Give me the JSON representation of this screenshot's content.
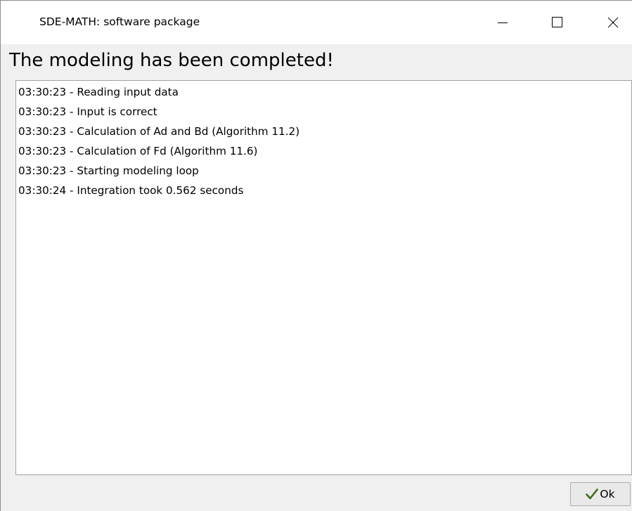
{
  "window": {
    "title": "SDE-MATH: software package"
  },
  "heading": "The modeling has been completed!",
  "log": {
    "lines": [
      "03:30:23 - Reading input data",
      "03:30:23 - Input is correct",
      "03:30:23 - Calculation of Ad and Bd (Algorithm 11.2)",
      "03:30:23 - Calculation of Fd (Algorithm 11.6)",
      "03:30:23 - Starting modeling loop",
      "03:30:24 - Integration took 0.562 seconds"
    ]
  },
  "buttons": {
    "ok_label": "Ok",
    "ok_icon": "checkmark-icon"
  },
  "colors": {
    "checkmark": "#3f6b1f",
    "window_background": "#f0f0f0",
    "titlebar_background": "#ffffff",
    "log_background": "#ffffff"
  }
}
